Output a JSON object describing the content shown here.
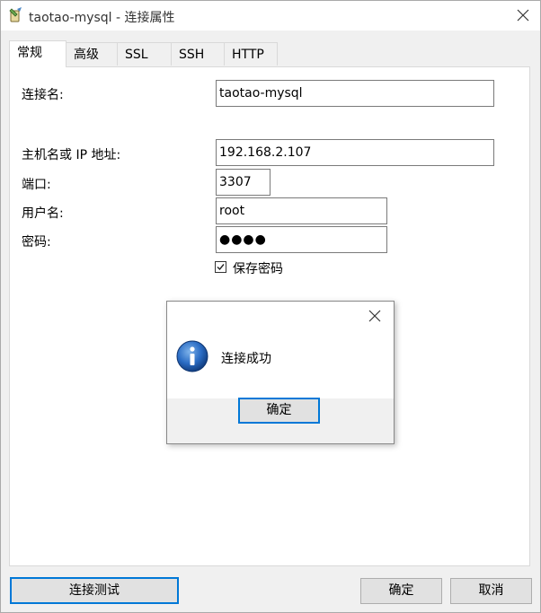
{
  "window": {
    "title": "taotao-mysql - 连接属性",
    "icon": "database-connection-icon"
  },
  "tabs": [
    {
      "label": "常规",
      "active": true
    },
    {
      "label": "高级",
      "active": false
    },
    {
      "label": "SSL",
      "active": false
    },
    {
      "label": "SSH",
      "active": false
    },
    {
      "label": "HTTP",
      "active": false
    }
  ],
  "form": {
    "connection_name_label": "连接名:",
    "connection_name_value": "taotao-mysql",
    "host_label": "主机名或 IP 地址:",
    "host_value": "192.168.2.107",
    "port_label": "端口:",
    "port_value": "3307",
    "user_label": "用户名:",
    "user_value": "root",
    "password_label": "密码:",
    "password_value": "●●●●",
    "save_password_label": "保存密码",
    "save_password_checked": true
  },
  "dialog": {
    "message": "连接成功",
    "ok_label": "确定",
    "icon": "info-icon"
  },
  "buttons": {
    "test_connection": "连接测试",
    "ok": "确定",
    "cancel": "取消"
  },
  "colors": {
    "focus_border": "#0078d7",
    "info_blue": "#1a5fb4"
  }
}
